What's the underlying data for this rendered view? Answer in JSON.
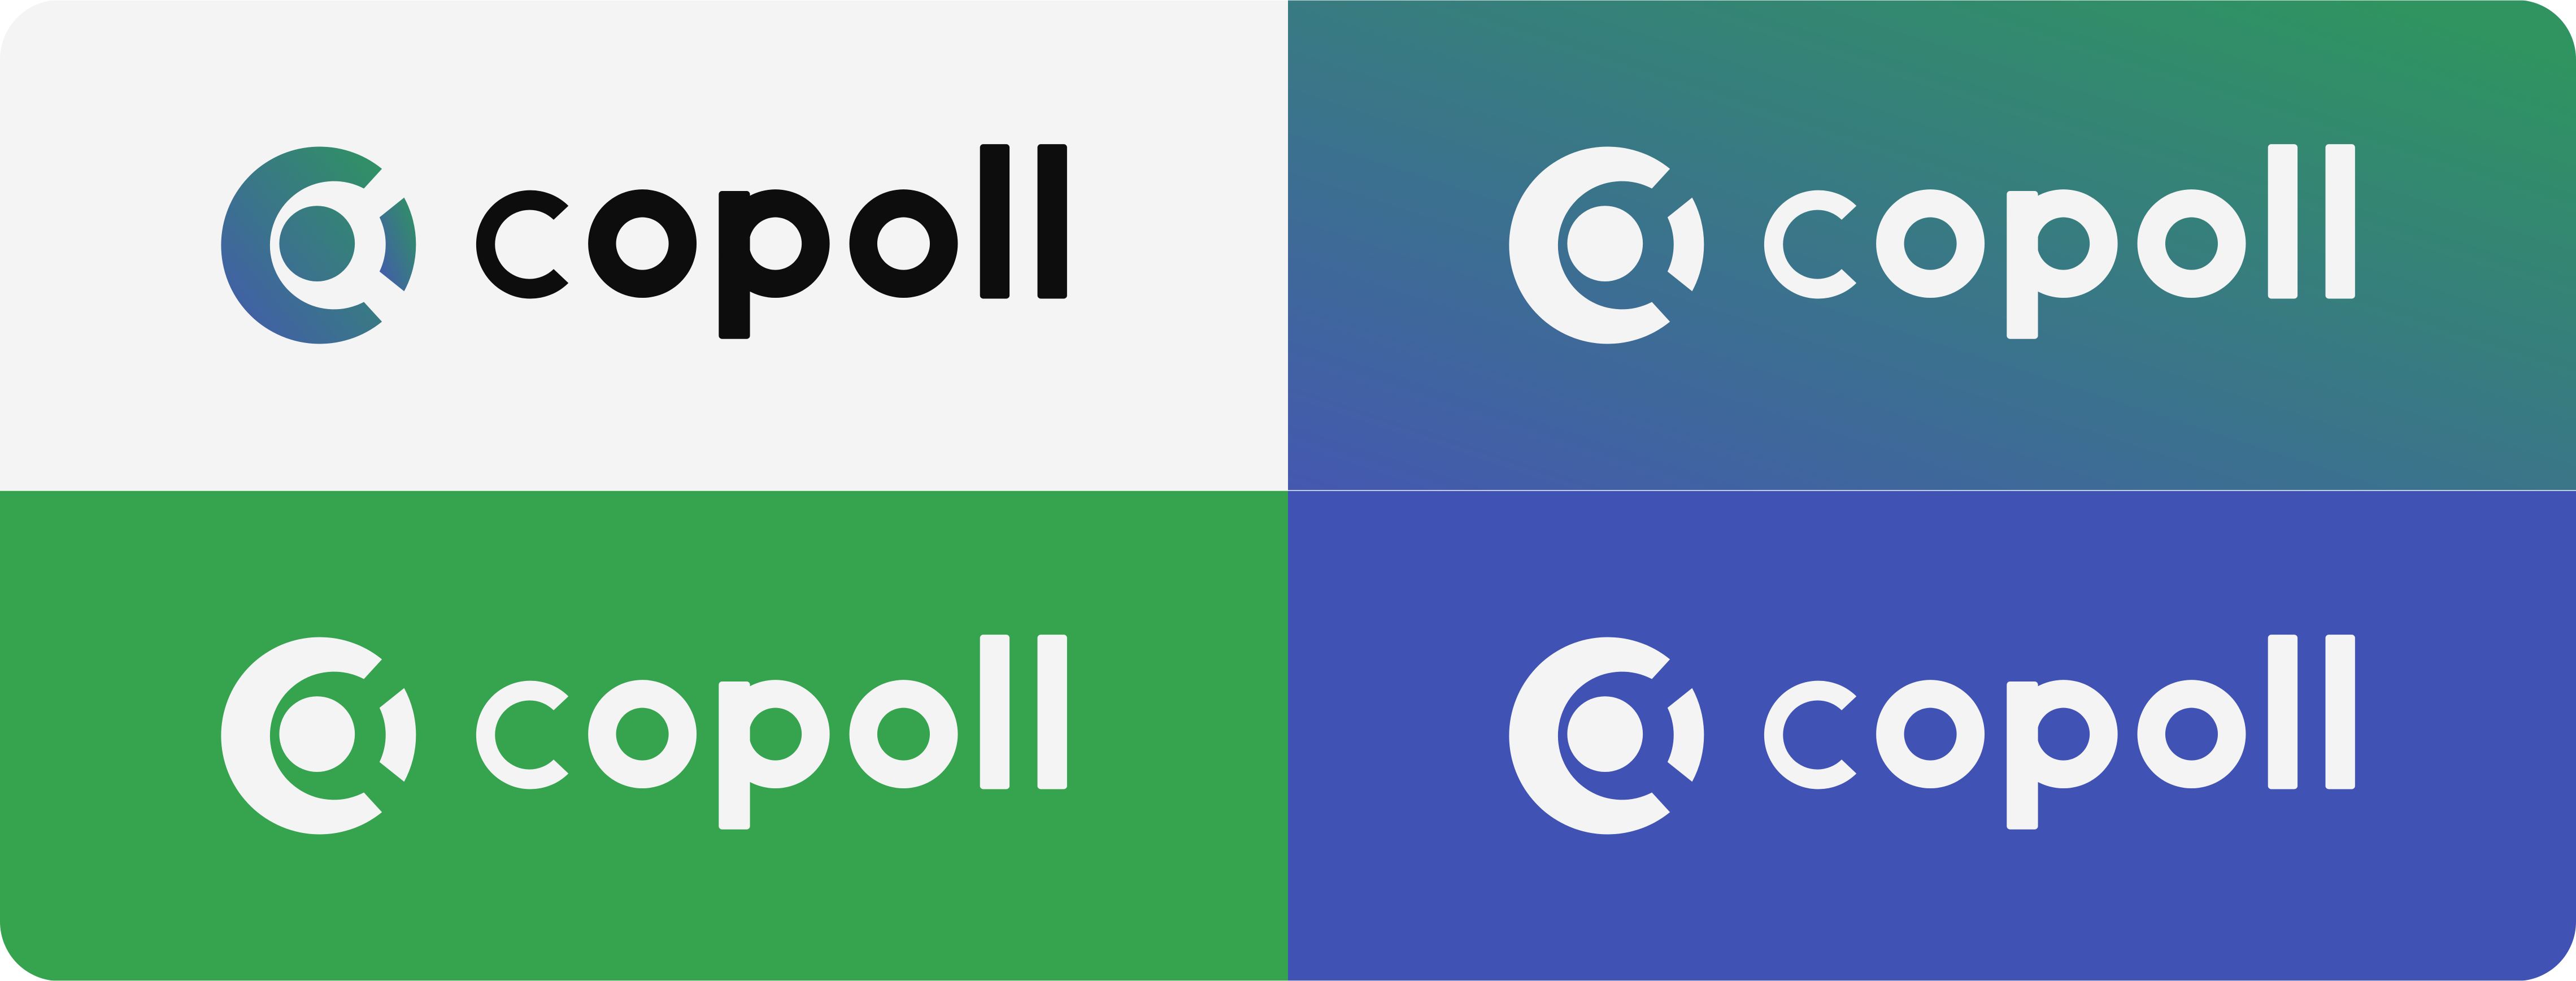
{
  "brand": {
    "name": "copoll"
  },
  "colors": {
    "light_background": "#f4f4f4",
    "dark_ink": "#0d0d0d",
    "light_ink": "#f4f4f4",
    "green": "#36a34f",
    "blue": "#4053b5",
    "gradient_green": "#2f9460",
    "gradient_blue": "#4458b0"
  },
  "panels": [
    {
      "id": "light",
      "background": "#f4f4f4",
      "mark_fill": "gradient",
      "wordmark_fill": "#0d0d0d",
      "wordmark": "copoll"
    },
    {
      "id": "gradient",
      "background": "gradient",
      "mark_fill": "#f4f4f4",
      "wordmark_fill": "#f4f4f4",
      "wordmark": "copoll"
    },
    {
      "id": "green",
      "background": "#36a34f",
      "mark_fill": "#f4f4f4",
      "wordmark_fill": "#f4f4f4",
      "wordmark": "copoll"
    },
    {
      "id": "blue",
      "background": "#4053b5",
      "mark_fill": "#f4f4f4",
      "wordmark_fill": "#f4f4f4",
      "wordmark": "copoll"
    }
  ]
}
